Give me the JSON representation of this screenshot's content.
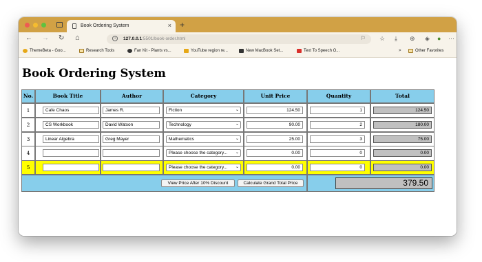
{
  "browser": {
    "tab_title": "Book Ordering System",
    "tab_close": "×",
    "new_tab": "+",
    "url_host": "127.0.0.1",
    "url_rest": ":5501/book-order.html",
    "nav": {
      "back": "←",
      "forward": "→",
      "reload": "↻",
      "home": "⌂"
    },
    "more": "···",
    "favorites": [
      {
        "label": "ThemeBeta - Goo...",
        "icon": "themebeta-icon",
        "color": "#e6a817"
      },
      {
        "label": "Research Tools",
        "icon": "folder-icon",
        "color": "#f7e2a8"
      },
      {
        "label": "Fan Kit - Plants vs...",
        "icon": "fankit-icon",
        "color": "#333333"
      },
      {
        "label": "YouTube region re...",
        "icon": "youtube-region-icon",
        "color": "#e6a817"
      },
      {
        "label": "New MacBook Set...",
        "icon": "macbook-icon",
        "color": "#333333"
      },
      {
        "label": "Text To Speech O...",
        "icon": "tts-icon",
        "color": "#d9302b"
      }
    ],
    "chevron_right": ">",
    "other_favorites": "Other Favorites"
  },
  "page": {
    "title": "Book Ordering System",
    "headers": [
      "No.",
      "Book Title",
      "Author",
      "Category",
      "Unit Price",
      "Quantity",
      "Total"
    ],
    "rows": [
      {
        "no": "1",
        "title": "Cafe Chaos",
        "author": "James R.",
        "category": "Fiction",
        "price": "124.50",
        "qty": "1",
        "total": "124.50",
        "highlight": false
      },
      {
        "no": "2",
        "title": "CS Workbook",
        "author": "David Watson",
        "category": "Technology",
        "price": "90.00",
        "qty": "2",
        "total": "180.00",
        "highlight": false
      },
      {
        "no": "3",
        "title": "Linear Algebra",
        "author": "Greg Mayer",
        "category": "Mathematics",
        "price": "25.00",
        "qty": "3",
        "total": "75.00",
        "highlight": false
      },
      {
        "no": "4",
        "title": "",
        "author": "",
        "category": "Please choose the category...",
        "price": "0.00",
        "qty": "0",
        "total": "0.00",
        "highlight": false
      },
      {
        "no": "5",
        "title": "",
        "author": "",
        "category": "Please choose the category...",
        "price": "0.00",
        "qty": "0",
        "total": "0.00",
        "highlight": true
      }
    ],
    "discount_button": "View Price After 10% Discount",
    "grand_total_button": "Calculate Grand Total Price",
    "grand_total": "379.50"
  },
  "colors": {
    "header_bg": "#87ceeb",
    "highlight_row": "#ffff00",
    "total_field": "#c0c0c0",
    "tab_strip": "#d1a145"
  }
}
